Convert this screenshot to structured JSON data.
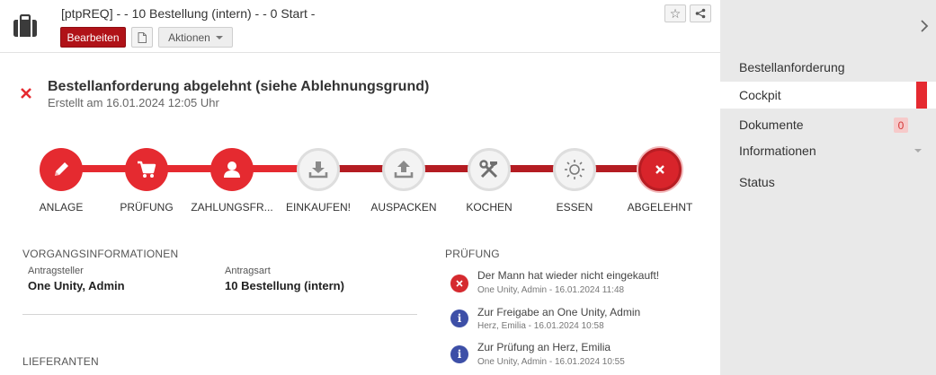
{
  "header": {
    "title": "[ptpREQ] - - 10 Bestellung (intern) - - 0 Start -",
    "edit_label": "Bearbeiten",
    "actions_label": "Aktionen",
    "icon": "briefcase-icon"
  },
  "sidebar": {
    "items": [
      {
        "label": "Bestellanforderung"
      },
      {
        "label": "Cockpit",
        "active": true
      },
      {
        "label": "Dokumente",
        "badge": "0"
      },
      {
        "label": "Informationen"
      },
      {
        "label": "Status"
      }
    ]
  },
  "status": {
    "title": "Bestellanforderung abgelehnt (siehe Ablehnungsgrund)",
    "subtitle": "Erstellt am 16.01.2024 12:05 Uhr"
  },
  "steps": [
    {
      "label": "ANLAGE",
      "icon": "pencil-icon",
      "state": "done"
    },
    {
      "label": "PRÜFUNG",
      "icon": "cart-icon",
      "state": "done"
    },
    {
      "label": "ZAHLUNGSFR...",
      "icon": "user-icon",
      "state": "done"
    },
    {
      "label": "EINKAUFEN!",
      "icon": "download-icon",
      "state": "open"
    },
    {
      "label": "AUSPACKEN",
      "icon": "upload-icon",
      "state": "open"
    },
    {
      "label": "KOCHEN",
      "icon": "tools-icon",
      "state": "open"
    },
    {
      "label": "ESSEN",
      "icon": "sun-icon",
      "state": "open"
    },
    {
      "label": "ABGELEHNT",
      "icon": "close-icon",
      "state": "rejected"
    }
  ],
  "vorgang": {
    "heading": "VORGANGSINFORMATIONEN",
    "antragsteller_label": "Antragsteller",
    "antragsteller_value": "One Unity, Admin",
    "antragsart_label": "Antragsart",
    "antragsart_value": "10 Bestellung (intern)"
  },
  "lieferanten": {
    "heading": "LIEFERANTEN"
  },
  "pruefung": {
    "heading": "PRÜFUNG",
    "entries": [
      {
        "type": "reject",
        "title": "Der Mann hat wieder nicht eingekauft!",
        "meta": "One Unity, Admin - 16.01.2024 11:48"
      },
      {
        "type": "info",
        "title": "Zur Freigabe an One Unity, Admin",
        "meta": "Herz, Emilia - 16.01.2024 10:58"
      },
      {
        "type": "info",
        "title": "Zur Prüfung an Herz, Emilia",
        "meta": "One Unity, Admin - 16.01.2024 10:55"
      }
    ]
  },
  "colors": {
    "accent": "#e52a30",
    "edit_button": "#b01218",
    "info": "#3d4fa7"
  }
}
